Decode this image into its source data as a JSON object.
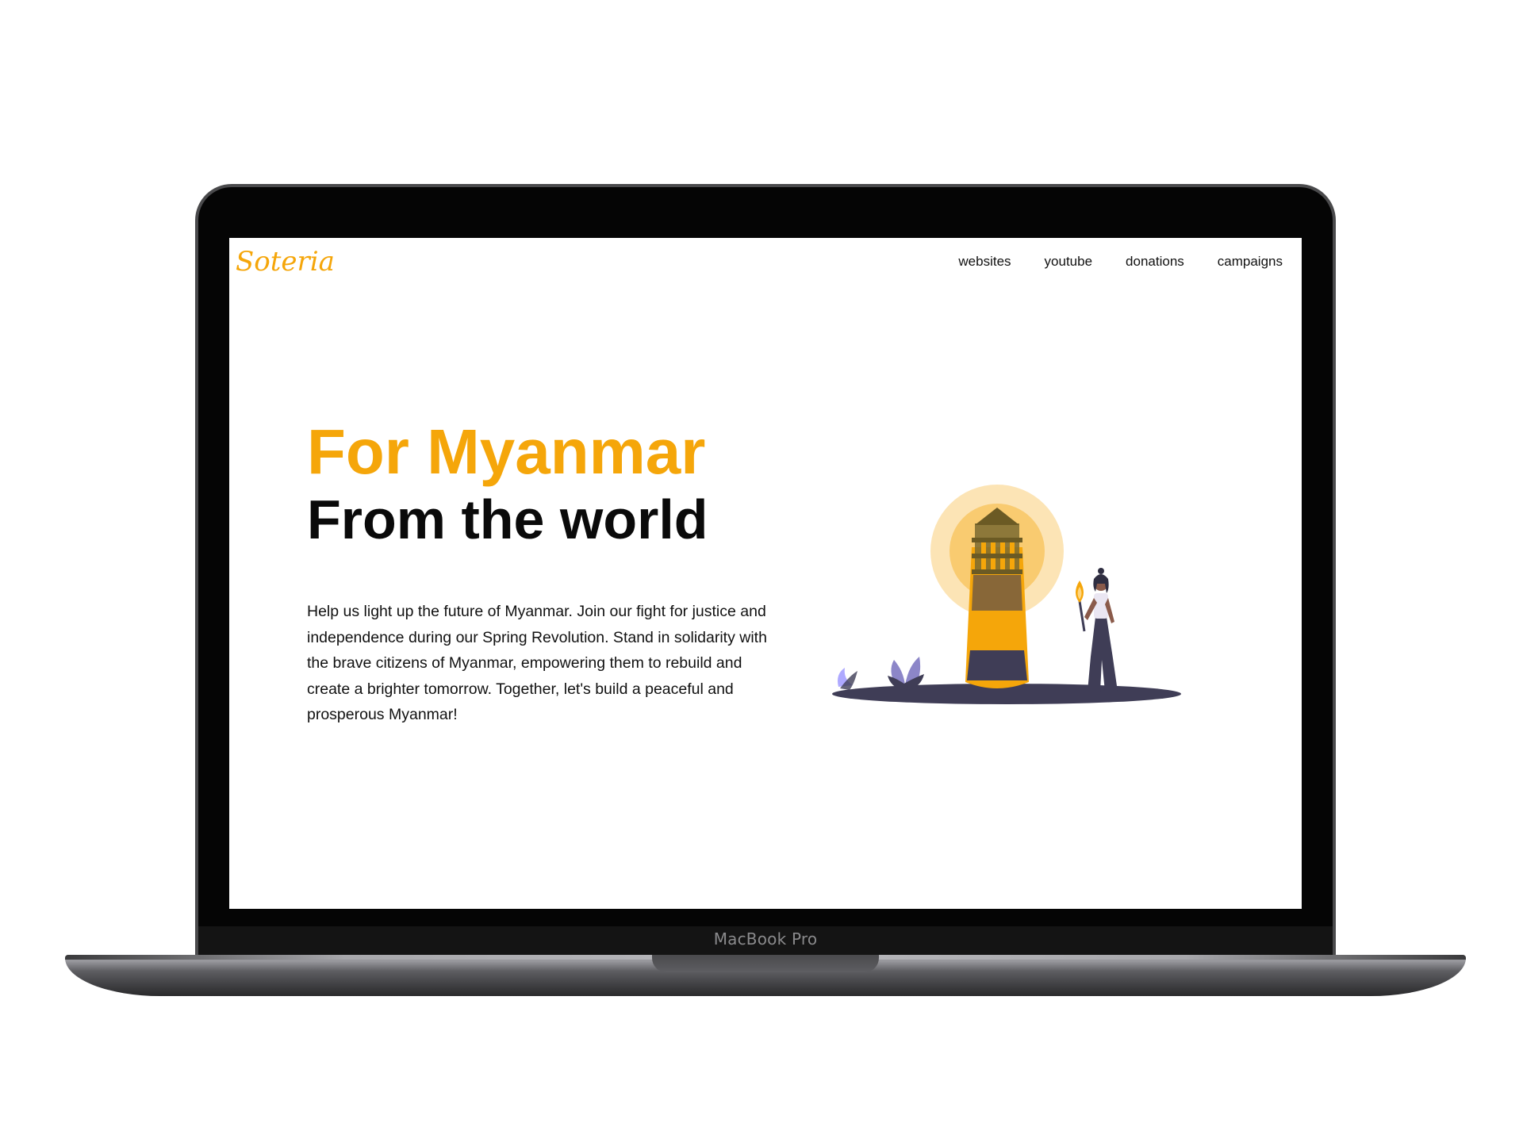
{
  "device": {
    "brand_label": "MacBook Pro"
  },
  "site": {
    "logo": "Soteria",
    "nav": [
      {
        "label": "websites"
      },
      {
        "label": "youtube"
      },
      {
        "label": "donations"
      },
      {
        "label": "campaigns"
      }
    ]
  },
  "hero": {
    "title_line1": "For Myanmar",
    "title_line2": "From the world",
    "body": "Help us light up the future of Myanmar. Join our fight for justice and independence during our Spring Revolution. Stand in solidarity with the brave citizens of Myanmar, empowering them to rebuild and create a brighter tomorrow. Together, let's build a peaceful and prosperous Myanmar!"
  },
  "illustration": {
    "subject": "woman holding torch beside lighthouse"
  },
  "colors": {
    "accent": "#f5a60a",
    "dark": "#3f3d56",
    "text": "#111111",
    "background": "#ffffff"
  }
}
